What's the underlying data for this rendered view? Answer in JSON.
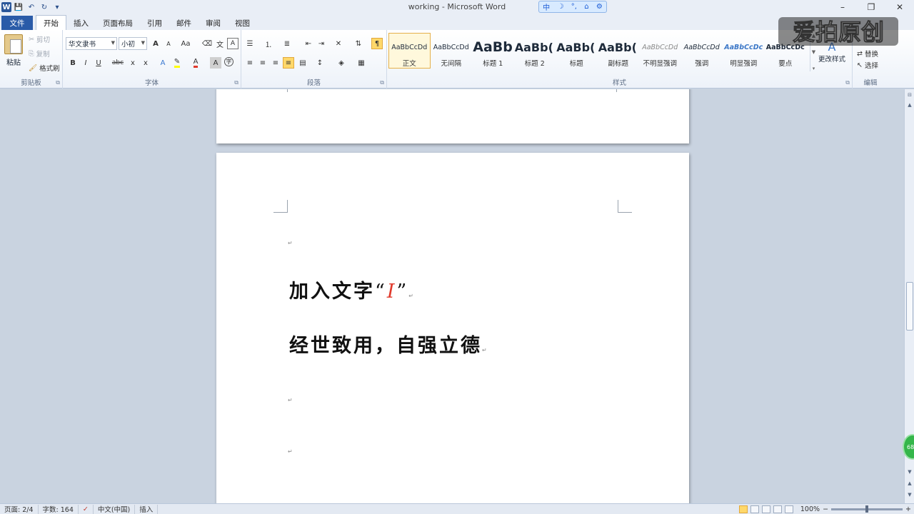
{
  "window": {
    "title": "working - Microsoft Word",
    "controls": {
      "minimize": "–",
      "restore": "❐",
      "close": "✕"
    }
  },
  "qat": {
    "logo": "W",
    "save_icon": "💾",
    "undo_icon": "↶",
    "redo_icon": "↻",
    "customize_icon": "▾"
  },
  "ime": {
    "lang": "中",
    "items": [
      "☽",
      "°,",
      "⌂",
      "⚙"
    ]
  },
  "tabs": {
    "file": "文件",
    "items": [
      "开始",
      "插入",
      "页面布局",
      "引用",
      "邮件",
      "审阅",
      "视图"
    ]
  },
  "clipboard": {
    "label": "剪贴板",
    "paste": "粘贴",
    "cut": "剪切",
    "copy": "复制",
    "format_painter": "格式刷"
  },
  "font": {
    "label": "字体",
    "name": "华文隶书",
    "size": "小初",
    "grow": "A",
    "shrink": "A",
    "case": "Aa",
    "bold": "B",
    "italic": "I",
    "underline": "U",
    "strike": "abc",
    "sub": "x",
    "sup": "x",
    "highlight_color": "#ffff00",
    "font_color": "#e03a2c"
  },
  "paragraph": {
    "label": "段落"
  },
  "styles": {
    "label": "样式",
    "change_styles": "更改样式",
    "items": [
      {
        "sample": "AaBbCcDd",
        "name": "正文"
      },
      {
        "sample": "AaBbCcDd",
        "name": "无间隔"
      },
      {
        "sample": "AaBb",
        "name": "标题 1"
      },
      {
        "sample": "AaBb(",
        "name": "标题 2"
      },
      {
        "sample": "AaBb(",
        "name": "标题"
      },
      {
        "sample": "AaBb(",
        "name": "副标题"
      },
      {
        "sample": "AaBbCcDd",
        "name": "不明显强调"
      },
      {
        "sample": "AaBbCcDd",
        "name": "强调"
      },
      {
        "sample": "AaBbCcDc",
        "name": "明显强调"
      },
      {
        "sample": "AaBbCcDc",
        "name": "要点"
      }
    ]
  },
  "editing": {
    "label": "编辑",
    "replace": "替换",
    "select": "选择"
  },
  "document": {
    "line1_prefix": "加入文字",
    "line1_quote_open": "“",
    "line1_quote_content": "I",
    "line1_quote_close": "”",
    "line2": "经世致用，自强立德",
    "para_mark": "↵"
  },
  "watermark": {
    "text": "爱拍原创"
  },
  "green_ball": {
    "text": "68"
  },
  "status": {
    "page": "页面: 2/4",
    "words": "字数: 164",
    "lang": "中文(中国)",
    "mode": "插入",
    "zoom": "100%",
    "zoom_level": 1.0
  }
}
